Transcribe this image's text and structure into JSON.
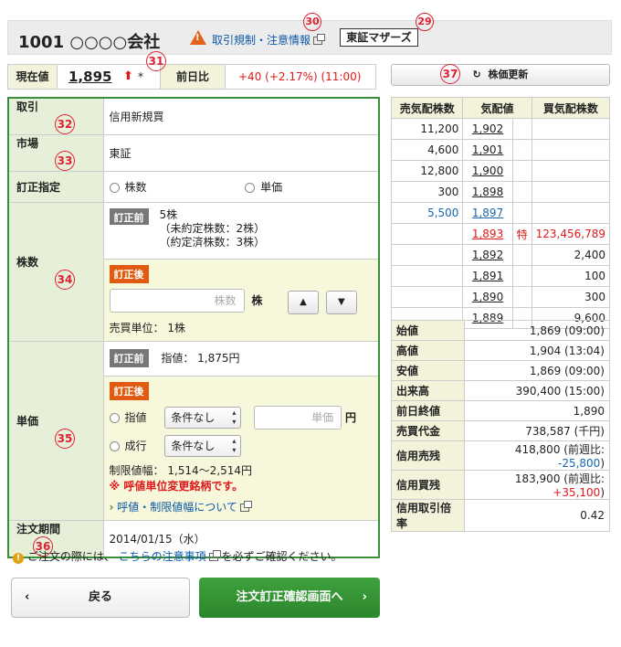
{
  "header": {
    "title": "1001 ○○○○会社",
    "regulation_link": "取引規制・注意情報",
    "market_tag": "東証マザーズ",
    "markers": {
      "m30": "30",
      "m29": "29",
      "m31": "31",
      "m37": "37"
    }
  },
  "price": {
    "current_label": "現在値",
    "current_value": "1,895",
    "asterisk": "*",
    "prev_label": "前日比",
    "change": "+40 (+2.17%) (11:00)"
  },
  "update_button": "株価更新",
  "form": {
    "torihiki_label": "取引",
    "torihiki_value": "信用新規買",
    "torihiki_marker": "32",
    "market_label": "市場",
    "market_value": "東証",
    "market_marker": "33",
    "correction_label": "訂正指定",
    "correction_opt1": "株数",
    "correction_opt2": "単価",
    "qty_label": "株数",
    "qty_marker": "34",
    "before_tag": "訂正前",
    "after_tag": "訂正後",
    "qty_before_1": "5株",
    "qty_before_2": "（未約定株数：2株）",
    "qty_before_3": "（約定済株数：3株）",
    "qty_placeholder": "株数",
    "qty_unit": "株",
    "up_arrow": "▲",
    "down_arrow": "▼",
    "trade_unit": "売買単位： 1株",
    "price_label": "単価",
    "price_marker": "35",
    "price_before": "指値： 1,875円",
    "limit_label": "指値",
    "limit_select": "条件なし",
    "price_placeholder": "単価",
    "price_unit": "円",
    "market_order_label": "成行",
    "market_select": "条件なし",
    "limit_range": "制限値幅： 1,514～2,514円",
    "tick_warning": "※ 呼値単位変更銘柄です。",
    "tick_link": "呼値・制限値幅について",
    "period_label": "注文期間",
    "period_value": "2014/01/15（水）",
    "period_marker": "36"
  },
  "board": {
    "headers": [
      "売気配株数",
      "気配値",
      "買気配株数"
    ],
    "rows": [
      {
        "sell": "11,200",
        "price": "1,902",
        "flag": "",
        "buy": ""
      },
      {
        "sell": "4,600",
        "price": "1,901",
        "flag": "",
        "buy": ""
      },
      {
        "sell": "12,800",
        "price": "1,900",
        "flag": "",
        "buy": ""
      },
      {
        "sell": "300",
        "price": "1,898",
        "flag": "",
        "buy": ""
      },
      {
        "sell": "5,500",
        "price": "1,897",
        "flag": "",
        "buy": ""
      },
      {
        "sell": "",
        "price": "1,893",
        "flag": "特",
        "buy": "123,456,789"
      },
      {
        "sell": "",
        "price": "1,892",
        "flag": "",
        "buy": "2,400"
      },
      {
        "sell": "",
        "price": "1,891",
        "flag": "",
        "buy": "100"
      },
      {
        "sell": "",
        "price": "1,890",
        "flag": "",
        "buy": "300"
      },
      {
        "sell": "",
        "price": "1,889",
        "flag": "",
        "buy": "9,600"
      }
    ]
  },
  "stats": [
    {
      "label": "始値",
      "value": "1,869 (09:00)"
    },
    {
      "label": "高値",
      "value": "1,904 (13:04)"
    },
    {
      "label": "安値",
      "value": "1,869 (09:00)"
    },
    {
      "label": "出来高",
      "value": "390,400 (15:00)"
    },
    {
      "label": "前日終値",
      "value": "1,890"
    },
    {
      "label": "売買代金",
      "value": "738,587 (千円)"
    },
    {
      "label": "信用売残",
      "value_pre": "418,800 (前週比: ",
      "delta": "-25,800",
      "value_post": ")"
    },
    {
      "label": "信用買残",
      "value_pre": "183,900 (前週比: ",
      "delta": "+35,100",
      "value_post": ")"
    },
    {
      "label": "信用取引倍率",
      "value": "0.42"
    }
  ],
  "note": {
    "prefix": "ご注文の際には、",
    "link": "こちらの注意事項",
    "suffix": "を必ずご確認ください。"
  },
  "buttons": {
    "back": "戻る",
    "confirm": "注文訂正確認画面へ"
  },
  "colors": {
    "accent_green": "#3a8e3a",
    "red": "#e0191a",
    "blue": "#1766b0",
    "orange": "#e05a10"
  }
}
